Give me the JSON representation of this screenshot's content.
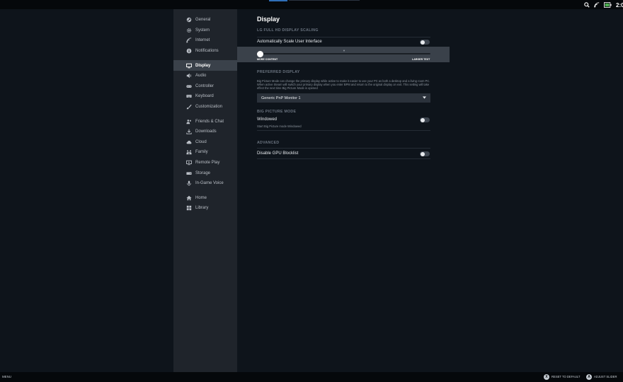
{
  "topbar": {
    "clock": "2:0",
    "icons": [
      "search-icon",
      "wifi-icon",
      "battery-icon"
    ]
  },
  "sidebar": {
    "groups": [
      [
        {
          "label": "General",
          "icon": "steam-icon"
        },
        {
          "label": "System",
          "icon": "gear-icon"
        },
        {
          "label": "Internet",
          "icon": "wifi-icon"
        },
        {
          "label": "Notifications",
          "icon": "info-icon"
        }
      ],
      [
        {
          "label": "Display",
          "icon": "monitor-icon",
          "active": true
        },
        {
          "label": "Audio",
          "icon": "speaker-icon"
        },
        {
          "label": "Controller",
          "icon": "gamepad-icon"
        },
        {
          "label": "Keyboard",
          "icon": "keyboard-icon"
        },
        {
          "label": "Customization",
          "icon": "brush-icon"
        }
      ],
      [
        {
          "label": "Friends & Chat",
          "icon": "friends-icon"
        },
        {
          "label": "Downloads",
          "icon": "download-icon"
        },
        {
          "label": "Cloud",
          "icon": "cloud-icon"
        },
        {
          "label": "Family",
          "icon": "family-icon"
        },
        {
          "label": "Remote Play",
          "icon": "remote-play-icon"
        },
        {
          "label": "Storage",
          "icon": "storage-icon"
        },
        {
          "label": "In-Game Voice",
          "icon": "microphone-icon"
        }
      ],
      [
        {
          "label": "Home",
          "icon": "home-icon"
        },
        {
          "label": "Library",
          "icon": "library-icon"
        }
      ]
    ]
  },
  "main": {
    "title": "Display",
    "scaling": {
      "heading": "LG FULL HD DISPLAY SCALING",
      "auto_scale_label": "Automatically Scale User Interface",
      "auto_scale_on": false,
      "slider_min_label": "MORE CONTENT",
      "slider_max_label": "LARGER TEXT",
      "slider_value": 0
    },
    "preferred": {
      "heading": "PREFERRED DISPLAY",
      "description": "Big Picture Mode can change the primary display while active to make it easier to use your PC as both a desktop and a living room PC. When active Steam will switch your primary display when you enter BPM and return to the original display on exit. This setting will take effect the next time Big Picture Mode is opened",
      "selected": "Generic PnP Monitor 1"
    },
    "bigpicture": {
      "heading": "BIG PICTURE MODE",
      "windowed_label": "Windowed",
      "windowed_sub": "Start Big Picture mode Windowed",
      "windowed_on": false
    },
    "advanced": {
      "heading": "ADVANCED",
      "gpu_label": "Disable GPU Blocklist",
      "gpu_on": false
    }
  },
  "bottombar": {
    "menu": "MENU",
    "hint1_btn": "X",
    "hint1_label": "RESET TO DEFAULT",
    "hint2_btn": "A",
    "hint2_label": "ADJUST SLIDER"
  }
}
